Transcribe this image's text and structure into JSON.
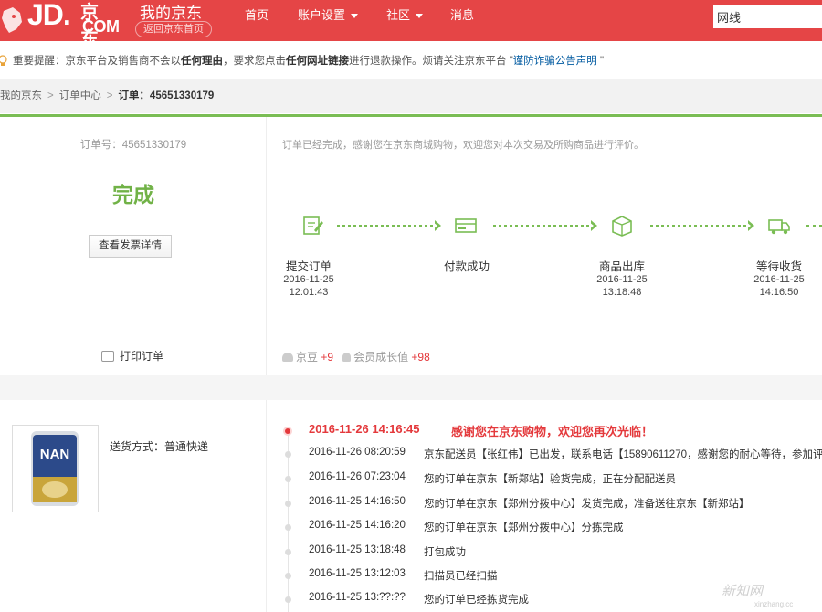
{
  "header": {
    "logo_jd": "JD.",
    "logo_cn": "京东",
    "logo_com": "COM",
    "title": "我的京东",
    "back_home": "返回京东首页",
    "nav": [
      {
        "label": "首页"
      },
      {
        "label": "账户设置"
      },
      {
        "label": "社区"
      },
      {
        "label": "消息"
      }
    ],
    "search_value": "网线",
    "brand_color": "#e54546"
  },
  "notice": {
    "lead": "重要提醒：京东平台及销售商不会以",
    "b1": "任何理由",
    "mid": "，要求您点击",
    "b2": "任何网址链接",
    "tail": "进行退款操作。烦请关注京东平台 \"",
    "link": "谨防诈骗公告声明",
    "end": " \""
  },
  "breadcrumb": [
    "我的京东",
    "订单中心",
    "订单：45651330179"
  ],
  "order": {
    "number_text": "订单号：45651330179",
    "status": "完成",
    "invoice_button": "查看发票详情",
    "print_label": "打印订单",
    "thanks": "订单已经完成，感谢您在京东商城购物，欢迎您对本次交易及所购商品进行评价。",
    "steps": [
      {
        "name": "提交订单",
        "date": "2016-11-25",
        "time": "12:01:43",
        "icon": "edit-order-icon"
      },
      {
        "name": "付款成功",
        "date": "",
        "time": "",
        "icon": "payment-card-icon"
      },
      {
        "name": "商品出库",
        "date": "2016-11-25",
        "time": "13:18:48",
        "icon": "package-box-icon"
      },
      {
        "name": "等待收货",
        "date": "2016-11-25",
        "time": "14:16:50",
        "icon": "delivery-truck-icon"
      }
    ],
    "beans_label": "京豆",
    "beans_value": "+9",
    "growth_label": "会员成长值",
    "growth_value": "+98",
    "accent_green": "#7abd54"
  },
  "package": {
    "delivery_label": "送货方式：普通快递",
    "product_image_text": "NAN",
    "tracking": [
      {
        "time": "2016-11-26 14:16:45",
        "msg": "感谢您在京东购物，欢迎您再次光临！"
      },
      {
        "time": "2016-11-26 08:20:59",
        "msg": "京东配送员【张红伟】已出发，联系电话【15890611270，感谢您的耐心等待，参加评价还"
      },
      {
        "time": "2016-11-26 07:23:04",
        "msg": "您的订单在京东【新郑站】验货完成，正在分配配送员"
      },
      {
        "time": "2016-11-25 14:16:50",
        "msg": "您的订单在京东【郑州分拨中心】发货完成，准备送往京东【新郑站】"
      },
      {
        "time": "2016-11-25 14:16:20",
        "msg": "您的订单在京东【郑州分拨中心】分拣完成"
      },
      {
        "time": "2016-11-25 13:18:48",
        "msg": "打包成功"
      },
      {
        "time": "2016-11-25 13:12:03",
        "msg": "扫描员已经扫描"
      },
      {
        "time": "2016-11-25 13:??:??",
        "msg": "您的订单已经拣货完成"
      }
    ]
  },
  "watermark": {
    "main": "新知网",
    "sub": "xinzhang.cc"
  }
}
